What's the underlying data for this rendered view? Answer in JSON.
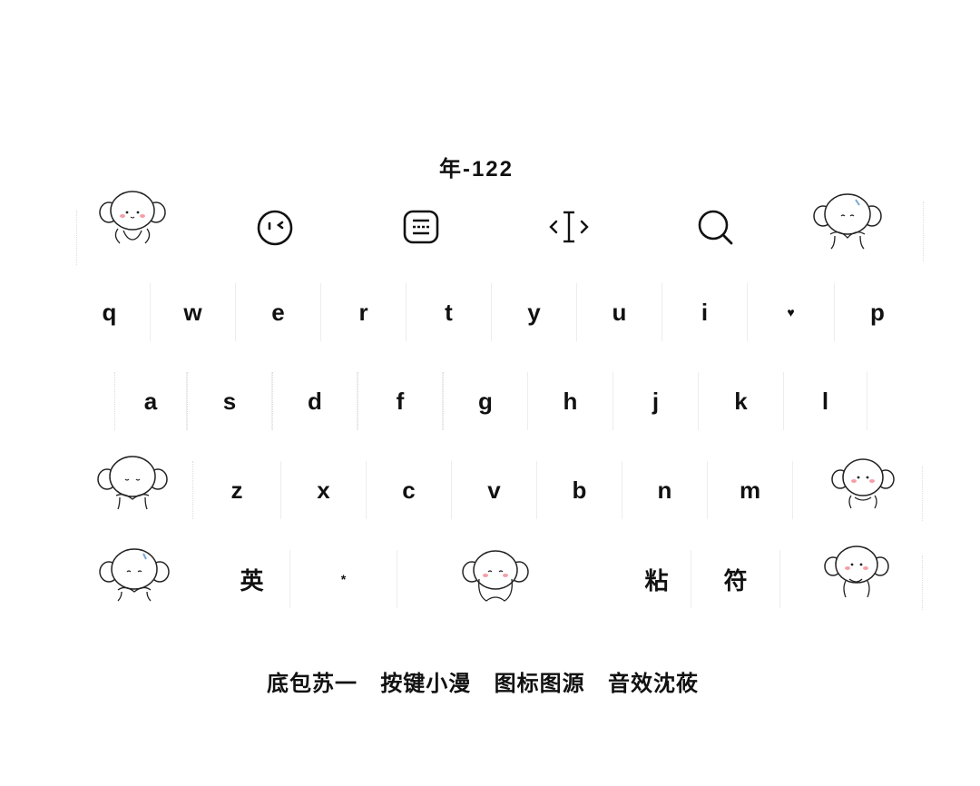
{
  "title": "年-122",
  "toolbar": {
    "icons": [
      "sticker-monkey-left",
      "emoji-face-icon",
      "keyboard-menu-icon",
      "cursor-move-icon",
      "search-icon",
      "sticker-monkey-right"
    ]
  },
  "rows": {
    "row1": [
      "q",
      "w",
      "e",
      "r",
      "t",
      "y",
      "u",
      "i",
      "♥",
      "p"
    ],
    "row2": [
      "a",
      "s",
      "d",
      "f",
      "g",
      "h",
      "j",
      "k",
      "l"
    ],
    "row3": [
      "z",
      "x",
      "c",
      "v",
      "b",
      "n",
      "m"
    ],
    "row4": {
      "lang": "英",
      "dot": "*",
      "paste": "粘",
      "symbols": "符"
    }
  },
  "footer": {
    "credit1": "底包苏一",
    "credit2": "按键小漫",
    "credit3": "图标图源",
    "credit4": "音效沈莜"
  },
  "colors": {
    "text": "#111111",
    "blush": "#f4a0a8",
    "background": "#ffffff"
  }
}
